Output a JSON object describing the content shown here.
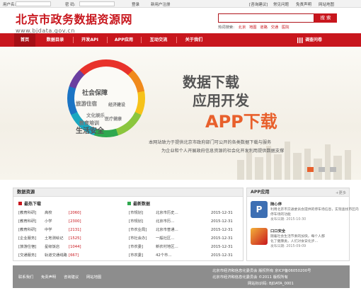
{
  "topbar": {
    "username_label": "用户名:",
    "password_label": "密 码:",
    "login": "登录",
    "register": "新用户注册",
    "right_links": [
      "[咨询建议]",
      "常见问题",
      "免责声明",
      "网站地图"
    ]
  },
  "header": {
    "title": "北京市政务数据资源网",
    "domain": "www.bjdata.gov.cn"
  },
  "search": {
    "placeholder": "",
    "button": "搜 索",
    "hot_label": "热词搜索:",
    "hot_words": [
      "北京",
      "地图",
      "道路",
      "交通",
      "医院"
    ]
  },
  "nav": {
    "items": [
      "首页",
      "数据目录",
      "开发API",
      "APP应用",
      "互动交流",
      "关于我们"
    ],
    "survey": "调查问卷"
  },
  "banner": {
    "ring_words": [
      "社会保障",
      "旅游住宿",
      "经济建设",
      "文化娱乐",
      "教育培训",
      "医疗健康",
      "生活安全"
    ],
    "headline1": "数据下载",
    "headline2": "应用开发",
    "headline3": "APP下载",
    "desc_line1": "本网站致力于提供北京市政府部门可公开的各类数据下载与服务",
    "desc_line2": "为企业和个人开展政府信息资源的社会化开发利用提供数据支撑"
  },
  "data_resources": {
    "title": "数据资源",
    "hot_title": "最热下载",
    "hot_rows": [
      {
        "cat": "[教育科研]",
        "name": "高校",
        "count": "[2060]"
      },
      {
        "cat": "[教育科研]",
        "name": "小学",
        "count": "[2300]"
      },
      {
        "cat": "[教育科研]",
        "name": "中学",
        "count": "[2131]"
      },
      {
        "cat": "[企业服务]",
        "name": "土地测绘记",
        "count": "[1525]"
      },
      {
        "cat": "[旅游住宿]",
        "name": "星级饭店",
        "count": "[1044]"
      },
      {
        "cat": "[交通服务]",
        "name": "轨道交通线路",
        "count": "[667]"
      }
    ],
    "latest_title": "最新数据",
    "latest_rows": [
      {
        "cat": "[市规划]",
        "name": "北京市历史…",
        "date": "2015-12-31"
      },
      {
        "cat": "[市规划]",
        "name": "北京市历…",
        "date": "2015-12-31"
      },
      {
        "cat": "[市农业局]",
        "name": "北京市普通…",
        "date": "2015-12-31"
      },
      {
        "cat": "[市社会办]",
        "name": "一般社区…",
        "date": "2015-12-31"
      },
      {
        "cat": "[市农委]",
        "name": "新农村地区…",
        "date": "2015-12-31"
      },
      {
        "cat": "[市农委]",
        "name": "42个市…",
        "date": "2015-12-31"
      }
    ]
  },
  "apps": {
    "title": "APP应用",
    "more": "+更多",
    "items": [
      {
        "name": "随心停",
        "desc1": "利用北京市交通委员会提供的停车场信息，实现查找市区内",
        "desc2": "停车场的功能",
        "date": "发布日期: 2015-10-30"
      },
      {
        "name": "口口安全",
        "desc1": "随着社会生活节奏的加快，每个人都",
        "desc2": "化了健康类，人们对食安化步…",
        "date": "发布日期: 2015-09-09"
      }
    ]
  },
  "footer": {
    "links": [
      "联系我们",
      "免责声明",
      "咨询建议",
      "网站地图"
    ],
    "line1": "北京市经济和信息化委员会  版权所有 京ICP备06050200号",
    "line2": "北京市经济和信息化委员会  ©2011 版权所有",
    "line3": "网站标识码: BJDATA_0001"
  },
  "colors": {
    "brand_red": "#c8161d",
    "accent_orange": "#e8602c"
  }
}
